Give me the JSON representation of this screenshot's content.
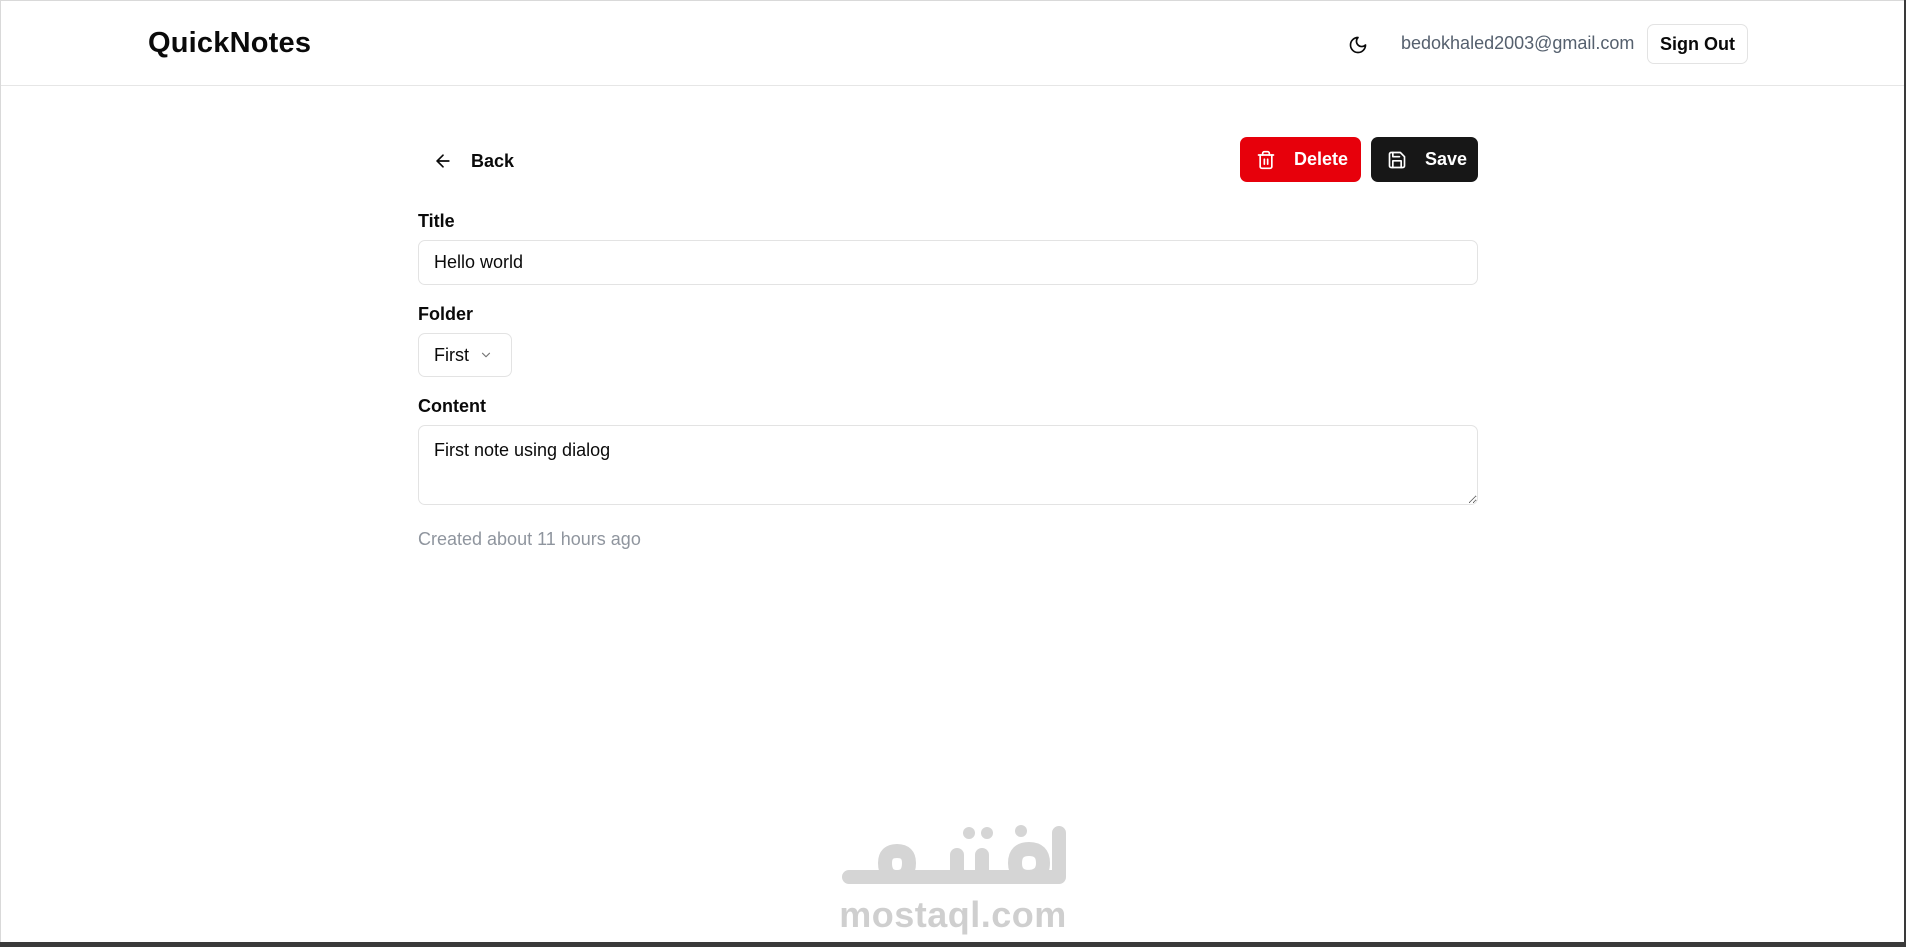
{
  "header": {
    "brand": "QuickNotes",
    "user_email": "bedokhaled2003@gmail.com",
    "sign_out_label": "Sign Out",
    "theme_icon": "moon-icon"
  },
  "toolbar": {
    "back_label": "Back",
    "delete_label": "Delete",
    "save_label": "Save"
  },
  "form": {
    "title_label": "Title",
    "title_value": "Hello world",
    "folder_label": "Folder",
    "folder_value": "First",
    "content_label": "Content",
    "content_value": "First note using dialog",
    "created_text": "Created about 11 hours ago"
  },
  "watermark": {
    "text": "mostaql.com"
  },
  "colors": {
    "delete": "#e7000b",
    "save": "#171717",
    "muted": "#8f959e"
  }
}
